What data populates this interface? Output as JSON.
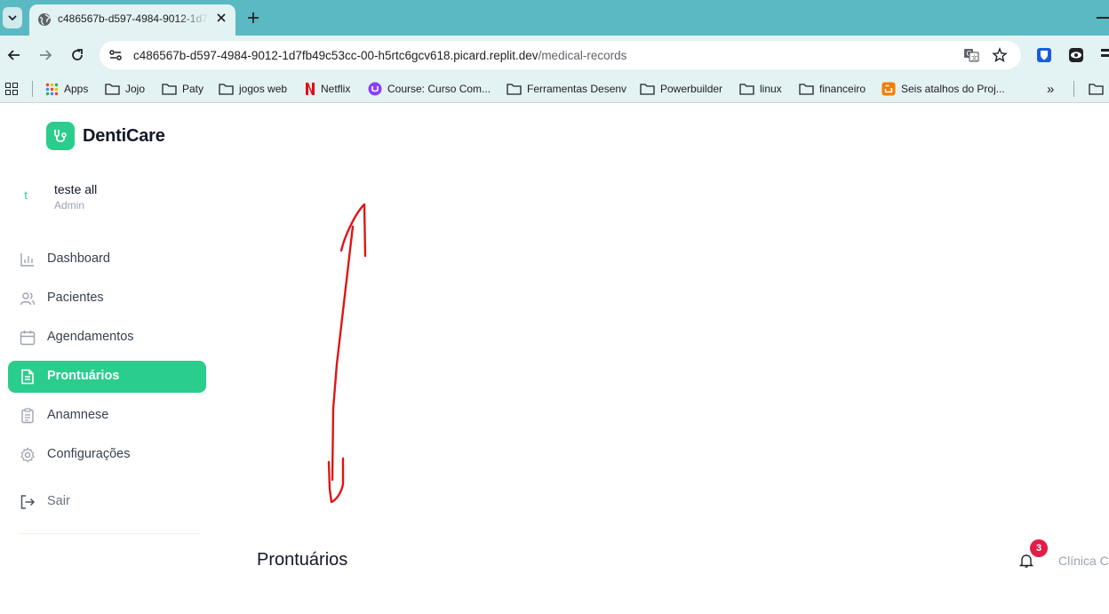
{
  "browser": {
    "tab_title": "c486567b-d597-4984-9012-1d7fb49c53cc-00-h5rtc6gcv618.picard.replit.dev",
    "url_host": "c486567b-d597-4984-9012-1d7fb49c53cc-00-h5rtc6gcv618.picard.replit.dev",
    "url_path": "/medical-records",
    "bookmarks": [
      {
        "label": "Apps",
        "icon": "apps-grid-icon"
      },
      {
        "label": "Jojo",
        "icon": "folder-icon"
      },
      {
        "label": "Paty",
        "icon": "folder-icon"
      },
      {
        "label": "jogos web",
        "icon": "folder-icon"
      },
      {
        "label": "Netflix",
        "icon": "netflix-icon"
      },
      {
        "label": "Course: Curso Com...",
        "icon": "course-icon"
      },
      {
        "label": "Ferramentas Desenv",
        "icon": "folder-icon"
      },
      {
        "label": "Powerbuilder",
        "icon": "folder-icon"
      },
      {
        "label": "linux",
        "icon": "folder-icon"
      },
      {
        "label": "financeiro",
        "icon": "folder-icon"
      },
      {
        "label": "Seis atalhos do Proj...",
        "icon": "blogger-icon"
      }
    ],
    "bookmarks_overflow": "»"
  },
  "app": {
    "brand": "DentiCare",
    "brand_color": "#2bcd8c",
    "user": {
      "initial": "t",
      "name": "teste all",
      "role": "Admin"
    },
    "nav": [
      {
        "label": "Dashboard",
        "icon": "bar-chart-icon",
        "active": false
      },
      {
        "label": "Pacientes",
        "icon": "users-icon",
        "active": false
      },
      {
        "label": "Agendamentos",
        "icon": "calendar-icon",
        "active": false
      },
      {
        "label": "Prontuários",
        "icon": "file-text-icon",
        "active": true
      },
      {
        "label": "Anamnese",
        "icon": "clipboard-icon",
        "active": false
      },
      {
        "label": "Configurações",
        "icon": "gear-icon",
        "active": false
      }
    ],
    "logout_label": "Sair",
    "page_title": "Prontuários",
    "notifications_count": "3",
    "clinic_label": "Clínica C"
  }
}
